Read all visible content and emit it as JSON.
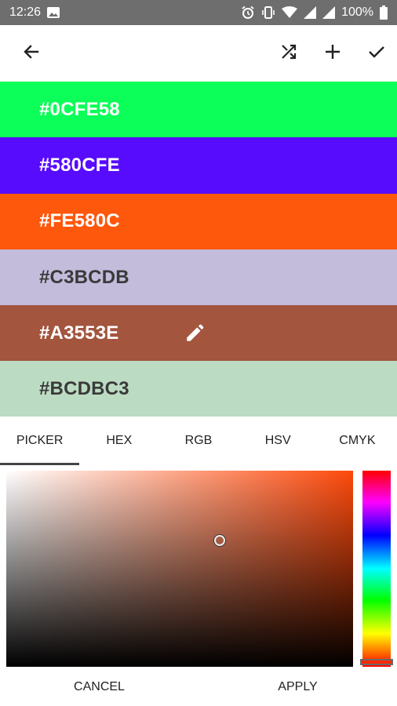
{
  "status_bar": {
    "time": "12:26",
    "battery": "100%",
    "icons": [
      "image-icon",
      "alarm-icon",
      "vibrate-icon",
      "wifi-icon",
      "signal-icon",
      "signal-icon",
      "battery-icon"
    ]
  },
  "toolbar": {
    "icons": [
      "back-arrow-icon",
      "shuffle-icon",
      "plus-icon",
      "check-icon"
    ]
  },
  "colors": [
    {
      "hex": "#0CFE58",
      "bg": "#0CFE58",
      "text_color": "#ffffff"
    },
    {
      "hex": "#580CFE",
      "bg": "#580CFE",
      "text_color": "#ffffff"
    },
    {
      "hex": "#FE580C",
      "bg": "#FE580C",
      "text_color": "#ffffff"
    },
    {
      "hex": "#C3BCDB",
      "bg": "#C3BCDB",
      "text_color": "#3a3a3a"
    },
    {
      "hex": "#A3553E",
      "bg": "#A3553E",
      "text_color": "#ffffff",
      "selected": true,
      "icon": "edit-pencil-icon"
    },
    {
      "hex": "#BCDBC3",
      "bg": "#BCDBC3",
      "text_color": "#3a3a3a"
    }
  ],
  "tabs": {
    "active": "PICKER",
    "items": [
      "PICKER",
      "HEX",
      "RGB",
      "HSV",
      "CMYK"
    ]
  },
  "actions": {
    "cancel": "CANCEL",
    "apply": "APPLY"
  }
}
